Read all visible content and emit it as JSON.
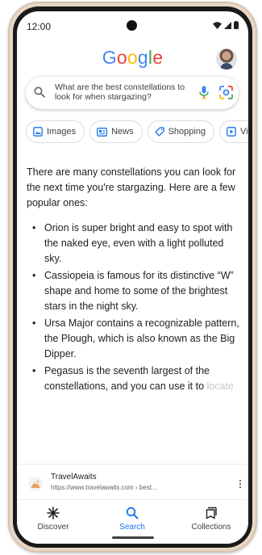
{
  "status_bar": {
    "time": "12:00",
    "icons": [
      "wifi-icon",
      "signal-icon",
      "battery-icon"
    ]
  },
  "header": {
    "logo_letters": [
      "G",
      "o",
      "o",
      "g",
      "l",
      "e"
    ],
    "logo_colors": [
      "#4285F4",
      "#EA4335",
      "#FBBC05",
      "#4285F4",
      "#34A853",
      "#EA4335"
    ],
    "avatar": "avatar"
  },
  "search": {
    "query": "What are the best constellations to look for when stargazing?",
    "icons": [
      "search-icon",
      "mic-icon",
      "lens-icon"
    ]
  },
  "chips": [
    {
      "label": "Images",
      "icon": "image-icon"
    },
    {
      "label": "News",
      "icon": "news-icon"
    },
    {
      "label": "Shopping",
      "icon": "tag-icon"
    },
    {
      "label": "Vide",
      "icon": "play-icon"
    }
  ],
  "answer": {
    "intro": "There are many constellations you can look for the next time you're stargazing. Here are a few popular ones:",
    "bullets": [
      "Orion is super bright and easy to spot with the naked eye, even with a light polluted sky.",
      "Cassiopeia is famous for its distinctive “W” shape and home to some of the brightest stars in the night sky.",
      "Ursa Major contains a recognizable pattern, the Plough, which is also known as the Big Dipper."
    ],
    "last_bullet_visible": "Pegasus is the seventh largest of the constellations, and you can use it to",
    "last_bullet_faded": "locate"
  },
  "source": {
    "name": "TravelAwaits",
    "url": "https://www.travelawaits.com › best...",
    "more_icon": "more-vert-icon"
  },
  "bottom_nav": {
    "items": [
      {
        "label": "Discover",
        "icon": "asterisk-icon",
        "active": false
      },
      {
        "label": "Search",
        "icon": "search-icon",
        "active": true
      },
      {
        "label": "Collections",
        "icon": "collections-icon",
        "active": false
      }
    ],
    "accent": "#1a73e8"
  }
}
